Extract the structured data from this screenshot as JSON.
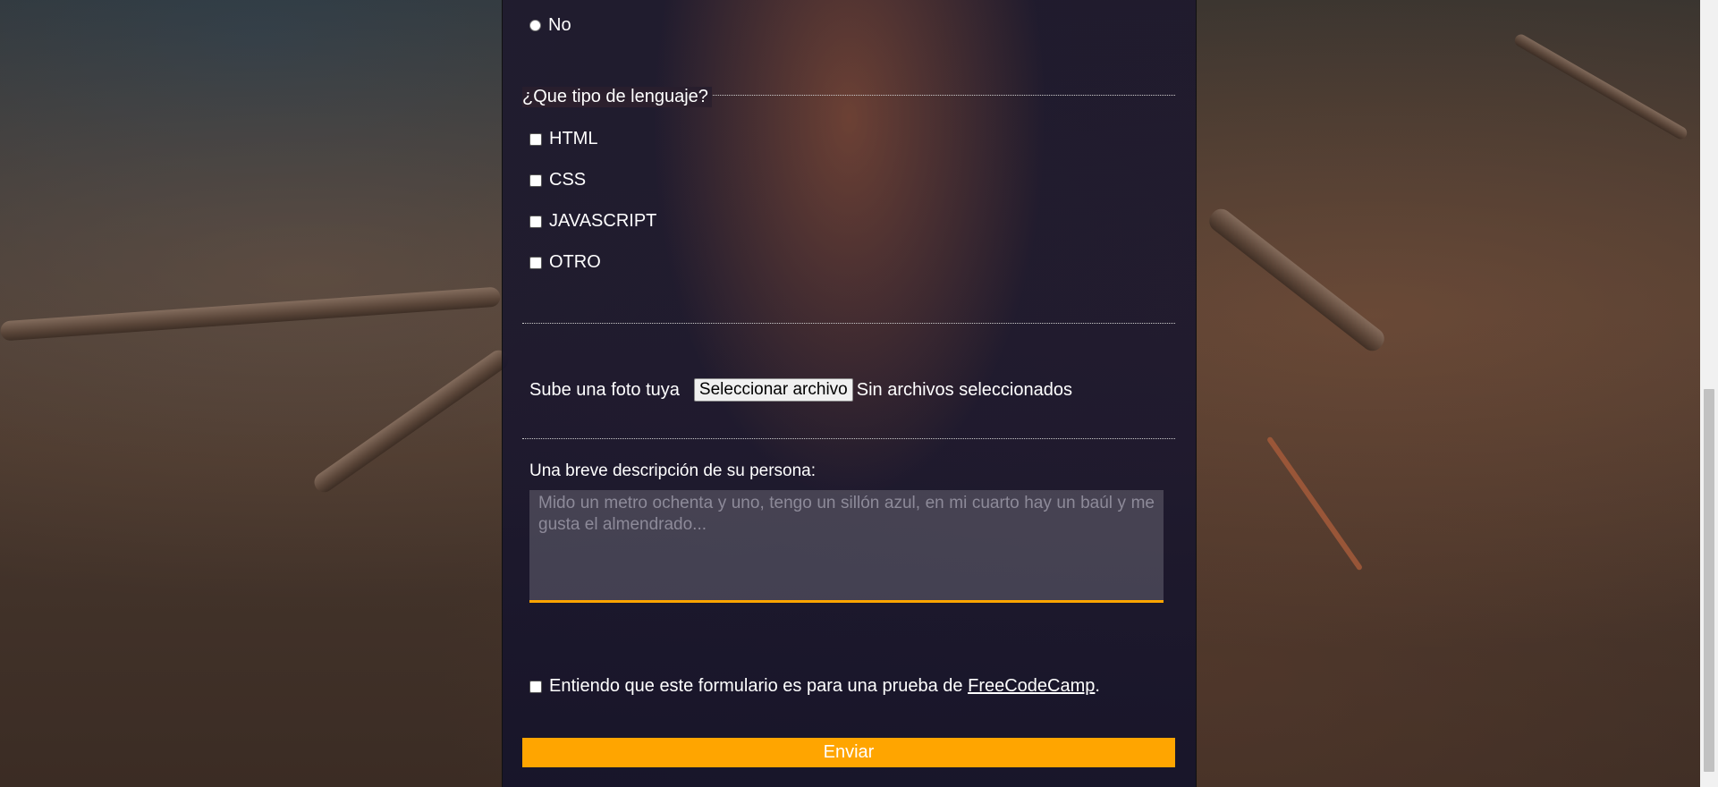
{
  "form": {
    "radio_no_label": "No",
    "language_legend": "¿Que tipo de lenguaje?",
    "languages": [
      "HTML",
      "CSS",
      "JAVASCRIPT",
      "OTRO"
    ],
    "photo_label": "Sube una foto tuya",
    "file_button_label": "Seleccionar archivo",
    "file_status": "Sin archivos seleccionados",
    "description_label": "Una breve descripción de su persona:",
    "description_placeholder": "Mido un metro ochenta y uno, tengo un sillón azul, en mi cuarto hay un baúl y me gusta el almendrado...",
    "consent_text": "Entiendo que este formulario es para una prueba de ",
    "consent_link": "FreeCodeCamp",
    "consent_end": ".",
    "submit_label": "Enviar"
  },
  "colors": {
    "accent": "#ffa500",
    "panel": "#1e1a30"
  }
}
